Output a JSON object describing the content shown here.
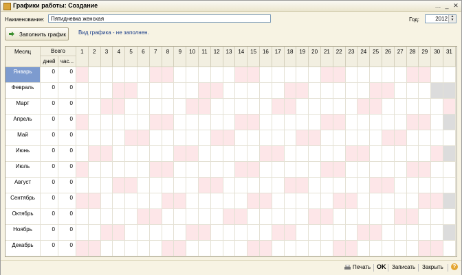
{
  "window": {
    "title": "Графики работы: Создание"
  },
  "form": {
    "name_label": "Наименование:",
    "name_value": "Пятидневка женская",
    "year_label": "Год:",
    "year_value": "2012",
    "fill_button": "Заполнить график",
    "hint": "Вид графика - не заполнен."
  },
  "table": {
    "month_header": "Месяц",
    "total_header": "Всего",
    "days_header": "дней",
    "hours_header": "час...",
    "day_numbers": [
      "1",
      "2",
      "3",
      "4",
      "5",
      "6",
      "7",
      "8",
      "9",
      "10",
      "11",
      "12",
      "13",
      "14",
      "15",
      "16",
      "17",
      "18",
      "19",
      "20",
      "21",
      "22",
      "23",
      "24",
      "25",
      "26",
      "27",
      "28",
      "29",
      "30",
      "31"
    ],
    "rows": [
      {
        "month": "Январь",
        "days": "0",
        "hours": "0",
        "weekends": [
          1,
          7,
          8,
          14,
          15,
          21,
          22,
          28,
          29
        ],
        "len": 31,
        "selected": true
      },
      {
        "month": "Февраль",
        "days": "0",
        "hours": "0",
        "weekends": [
          4,
          5,
          11,
          12,
          18,
          19,
          25,
          26
        ],
        "len": 29
      },
      {
        "month": "Март",
        "days": "0",
        "hours": "0",
        "weekends": [
          3,
          4,
          10,
          11,
          17,
          18,
          24,
          25,
          31
        ],
        "len": 31
      },
      {
        "month": "Апрель",
        "days": "0",
        "hours": "0",
        "weekends": [
          1,
          7,
          8,
          14,
          15,
          21,
          22,
          28,
          29
        ],
        "len": 30
      },
      {
        "month": "Май",
        "days": "0",
        "hours": "0",
        "weekends": [
          5,
          6,
          12,
          13,
          19,
          20,
          26,
          27
        ],
        "len": 31
      },
      {
        "month": "Июнь",
        "days": "0",
        "hours": "0",
        "weekends": [
          2,
          3,
          9,
          10,
          16,
          17,
          23,
          24,
          30
        ],
        "len": 30
      },
      {
        "month": "Июль",
        "days": "0",
        "hours": "0",
        "weekends": [
          1,
          7,
          8,
          14,
          15,
          21,
          22,
          28,
          29
        ],
        "len": 31
      },
      {
        "month": "Август",
        "days": "0",
        "hours": "0",
        "weekends": [
          4,
          5,
          11,
          12,
          18,
          19,
          25,
          26
        ],
        "len": 31
      },
      {
        "month": "Сентябрь",
        "days": "0",
        "hours": "0",
        "weekends": [
          1,
          2,
          8,
          9,
          15,
          16,
          22,
          23,
          29,
          30
        ],
        "len": 30
      },
      {
        "month": "Октябрь",
        "days": "0",
        "hours": "0",
        "weekends": [
          6,
          7,
          13,
          14,
          20,
          21,
          27,
          28
        ],
        "len": 31
      },
      {
        "month": "Ноябрь",
        "days": "0",
        "hours": "0",
        "weekends": [
          3,
          4,
          10,
          11,
          17,
          18,
          24,
          25
        ],
        "len": 30
      },
      {
        "month": "Декабрь",
        "days": "0",
        "hours": "0",
        "weekends": [
          1,
          2,
          8,
          9,
          15,
          16,
          22,
          23,
          29,
          30
        ],
        "len": 31
      }
    ]
  },
  "footer": {
    "print": "Печать",
    "ok": "OK",
    "save": "Записать",
    "close": "Закрыть",
    "help": "?"
  },
  "colors": {
    "weekend": "#fde6e8",
    "unavailable": "#dcdcdc",
    "selected": "#7d9bcf",
    "link": "#1c3f8a"
  }
}
